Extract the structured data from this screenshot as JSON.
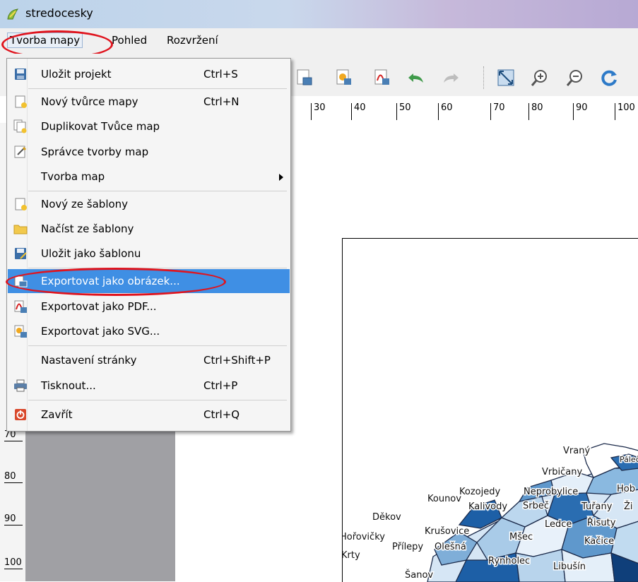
{
  "window": {
    "title": "stredocesky"
  },
  "menubar": {
    "items": [
      {
        "label": "Tvorba mapy"
      },
      {
        "label": "Pohled"
      },
      {
        "label": "Rozvržení"
      }
    ]
  },
  "menu": {
    "items": [
      {
        "label": "Uložit projekt",
        "shortcut": "Ctrl+S",
        "icon": "save-icon"
      },
      {
        "label": "Nový tvůrce mapy",
        "shortcut": "Ctrl+N",
        "icon": "new-composer-icon"
      },
      {
        "label": "Duplikovat Tvůce map",
        "shortcut": "",
        "icon": "duplicate-composer-icon"
      },
      {
        "label": "Správce tvorby map",
        "shortcut": "",
        "icon": "composer-manager-icon"
      },
      {
        "label": "Tvorba map",
        "shortcut": "",
        "icon": ""
      },
      {
        "label": "Nový ze šablony",
        "shortcut": "",
        "icon": "new-from-template-icon"
      },
      {
        "label": "Načíst ze šablony",
        "shortcut": "",
        "icon": "folder-icon"
      },
      {
        "label": "Uložit jako šablonu",
        "shortcut": "",
        "icon": "save-as-template-icon"
      },
      {
        "label": "Exportovat jako obrázek...",
        "shortcut": "",
        "icon": "export-image-icon"
      },
      {
        "label": "Exportovat jako PDF...",
        "shortcut": "",
        "icon": "export-pdf-icon"
      },
      {
        "label": "Exportovat jako SVG...",
        "shortcut": "",
        "icon": "export-svg-icon"
      },
      {
        "label": "Nastavení stránky",
        "shortcut": "Ctrl+Shift+P",
        "icon": ""
      },
      {
        "label": "Tisknout...",
        "shortcut": "Ctrl+P",
        "icon": "printer-icon"
      },
      {
        "label": "Zavřít",
        "shortcut": "Ctrl+Q",
        "icon": "close-icon"
      }
    ]
  },
  "ruler_top": {
    "ticks": [
      "30",
      "40",
      "50",
      "60",
      "70",
      "80",
      "90",
      "100"
    ]
  },
  "ruler_left": {
    "ticks": [
      "70",
      "80",
      "90",
      "100"
    ]
  },
  "map": {
    "labels": [
      "Vraný",
      "Páleč",
      "Vrbičany",
      "Hob",
      "Kozojedy",
      "Neprobylice",
      "Kounov",
      "Kalivody",
      "Srbeč",
      "Tuřany",
      "Ži",
      "Děkov",
      "Ledce",
      "Řisuty",
      "Hořovičky",
      "Krušovice",
      "Mšec",
      "Kačice",
      "Přílepy",
      "Olešná",
      "Krty",
      "Rynholec",
      "Libušín",
      "Šanov"
    ]
  },
  "colors": {
    "highlight": "#3f8fe4",
    "annotation": "#e0141e",
    "pane": "#a0a0a4"
  }
}
